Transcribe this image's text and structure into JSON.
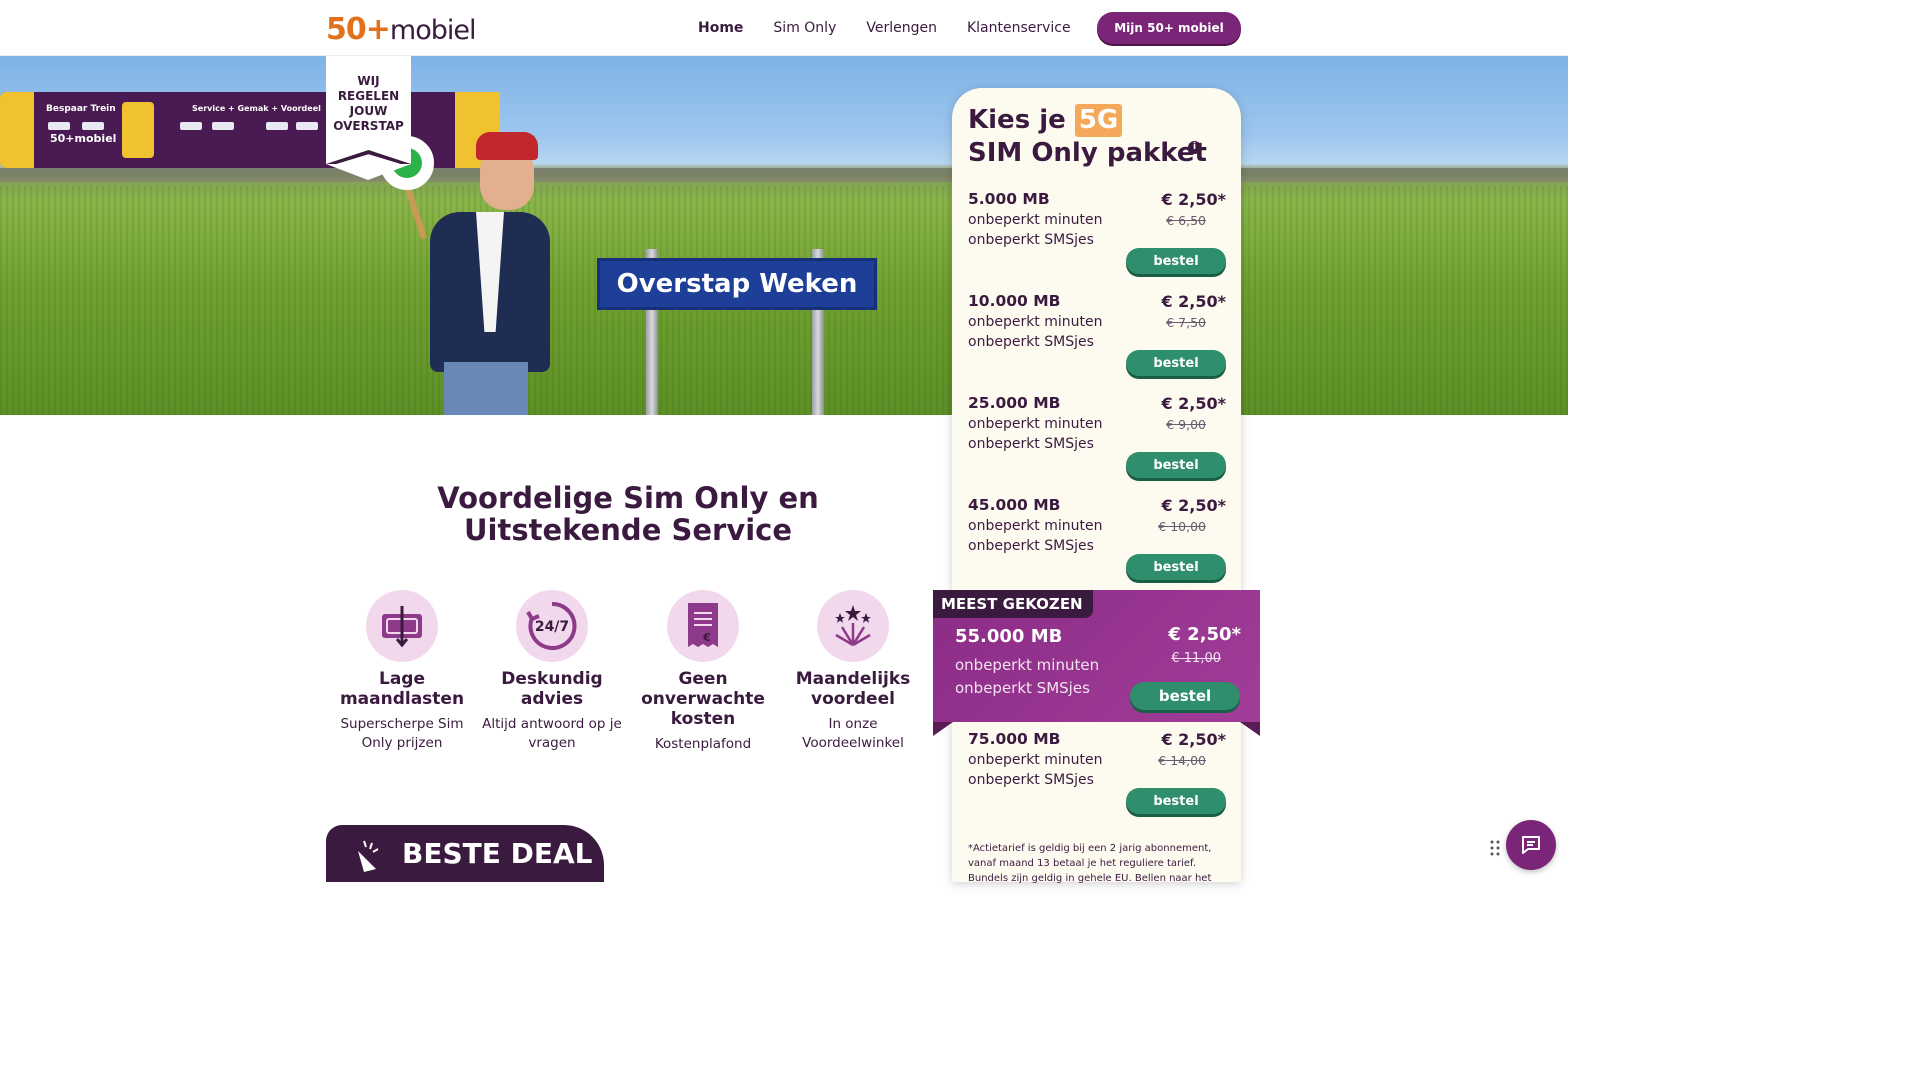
{
  "header": {
    "logo_num": "50+",
    "logo_word": "mobiel",
    "nav": [
      {
        "label": "Home"
      },
      {
        "label": "Sim Only"
      },
      {
        "label": "Verlengen"
      },
      {
        "label": "Klantenservice"
      }
    ],
    "account_button": "Mijn 50+ mobiel"
  },
  "hero": {
    "badge_lines": [
      "WIJ",
      "REGELEN",
      "JOUW",
      "OVERSTAP"
    ],
    "sign": "Overstap Weken",
    "train_text_1": "Bespaar Trein",
    "train_text_2": "50+mobiel",
    "train_text_3": "Service + Gemak + Voordeel"
  },
  "main": {
    "headline_1": "Voordelige Sim Only en",
    "headline_2": "Uitstekende Service",
    "features": [
      {
        "title": "Lage maandlasten",
        "sub": "Superscherpe Sim Only prijzen",
        "icon": "wallet-icon"
      },
      {
        "title": "Deskundig advies",
        "sub": "Altijd antwoord op je vragen",
        "icon": "clock-24-7-icon"
      },
      {
        "title": "Geen onverwachte kosten",
        "sub": "Kostenplafond",
        "icon": "receipt-icon"
      },
      {
        "title": "Maandelijks voordeel",
        "sub": "In onze Voordeelwinkel",
        "icon": "fireworks-icon"
      }
    ],
    "beste_deal": "BESTE DEAL"
  },
  "panel": {
    "title_1": "Kies je",
    "title_badge": "5G",
    "title_2": "SIM Only pakket",
    "plans": [
      {
        "mb": "5.000 MB",
        "minutes": "onbeperkt minuten",
        "sms": "onbeperkt SMSjes",
        "price": "€ 2,50*",
        "old_price": "€ 6,50",
        "button": "bestel"
      },
      {
        "mb": "10.000 MB",
        "minutes": "onbeperkt minuten",
        "sms": "onbeperkt SMSjes",
        "price": "€ 2,50*",
        "old_price": "€ 7,50",
        "button": "bestel"
      },
      {
        "mb": "25.000 MB",
        "minutes": "onbeperkt minuten",
        "sms": "onbeperkt SMSjes",
        "price": "€ 2,50*",
        "old_price": "€ 9,00",
        "button": "bestel"
      },
      {
        "mb": "45.000 MB",
        "minutes": "onbeperkt minuten",
        "sms": "onbeperkt SMSjes",
        "price": "€ 2,50*",
        "old_price": "€ 10,00",
        "button": "bestel"
      },
      {
        "mb": "75.000 MB",
        "minutes": "onbeperkt minuten",
        "sms": "onbeperkt SMSjes",
        "price": "€ 2,50*",
        "old_price": "€ 14,00",
        "button": "bestel"
      }
    ],
    "featured": {
      "tag": "MEEST GEKOZEN",
      "mb": "55.000 MB",
      "minutes": "onbeperkt minuten",
      "sms": "onbeperkt SMSjes",
      "price": "€ 2,50*",
      "old_price": "€ 11,00",
      "button": "bestel"
    },
    "footnote": "*Actietarief is geldig bij een 2 jarig abonnement, vanaf maand 13 betaal je het reguliere tarief. Bundels zijn geldig in gehele EU. Bellen naar het"
  },
  "colors": {
    "brand_purple": "#7b2578",
    "dark_purple": "#3b1a3f",
    "brand_orange": "#e2711d",
    "button_green": "#2f8e6b"
  }
}
